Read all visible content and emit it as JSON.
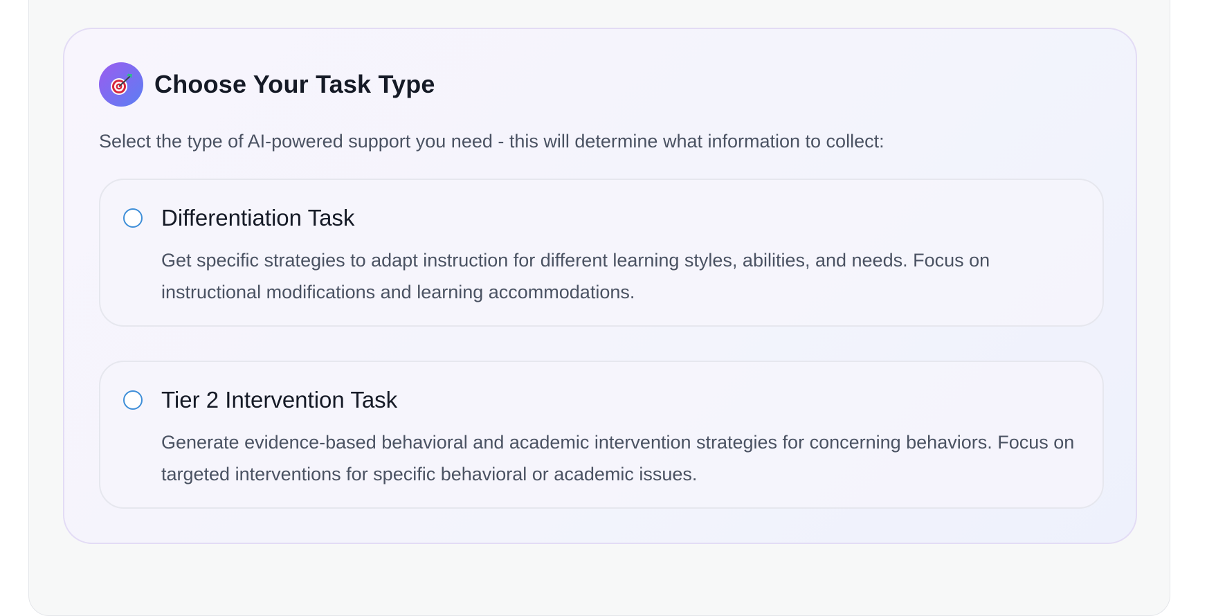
{
  "task_section": {
    "icon": "target-dart-icon",
    "title": "Choose Your Task Type",
    "description": "Select the type of AI-powered support you need - this will determine what information to collect:",
    "accent_gradient": [
      "#9b5cf0",
      "#5b7ff2"
    ],
    "radio_color": "#3f8fd8",
    "options": [
      {
        "title": "Differentiation Task",
        "description": "Get specific strategies to adapt instruction for different learning styles, abilities, and needs. Focus on instructional modifications and learning accommodations.",
        "selected": false
      },
      {
        "title": "Tier 2 Intervention Task",
        "description": "Generate evidence-based behavioral and academic intervention strategies for concerning behaviors. Focus on targeted interventions for specific behavioral or academic issues.",
        "selected": false
      }
    ]
  }
}
